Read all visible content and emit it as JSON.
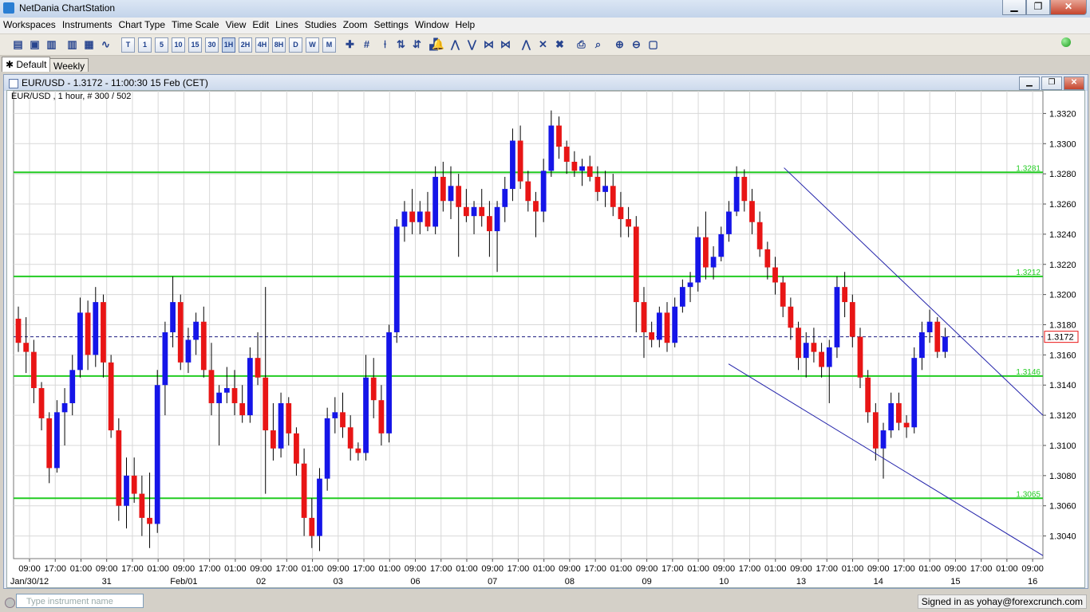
{
  "app": {
    "title": "NetDania ChartStation"
  },
  "menu": [
    "Workspaces",
    "Instruments",
    "Chart Type",
    "Time Scale",
    "View",
    "Edit",
    "Lines",
    "Studies",
    "Zoom",
    "Settings",
    "Window",
    "Help"
  ],
  "toolbar": {
    "timeframes": [
      "T",
      "1",
      "5",
      "10",
      "15",
      "30",
      "1H",
      "2H",
      "4H",
      "8H",
      "D",
      "W",
      "M"
    ],
    "selected_timeframe": "1H"
  },
  "tabs": [
    {
      "label": "Default",
      "active": true
    },
    {
      "label": "Weekly",
      "active": false
    }
  ],
  "chart_window": {
    "title": "EUR/USD - 1.3172 - 11:00:30  15 Feb (CET)",
    "info": "EUR/USD , 1 hour, # 300 / 502"
  },
  "statusbar": {
    "instrument_placeholder": "Type instrument name",
    "signed_in": "Signed in as yohay@forexcrunch.com"
  },
  "chart_data": {
    "type": "candlestick",
    "symbol": "EUR/USD",
    "interval": "1 hour",
    "ylim": [
      1.3025,
      1.3335
    ],
    "y_ticks": [
      "1.3320",
      "1.3300",
      "1.3280",
      "1.3260",
      "1.3240",
      "1.3220",
      "1.3200",
      "1.3180",
      "1.3160",
      "1.3140",
      "1.3120",
      "1.3100",
      "1.3080",
      "1.3060",
      "1.3040"
    ],
    "x_time_labels": [
      "09:00",
      "17:00",
      "01:00",
      "09:00",
      "17:00",
      "01:00",
      "09:00",
      "17:00",
      "01:00",
      "09:00",
      "17:00",
      "01:00",
      "09:00",
      "17:00",
      "01:00",
      "09:00",
      "17:00",
      "01:00",
      "09:00",
      "17:00",
      "01:00",
      "09:00",
      "17:00",
      "01:00",
      "09:00",
      "17:00",
      "01:00",
      "09:00",
      "17:00",
      "01:00",
      "09:00",
      "17:00",
      "01:00",
      "09:00",
      "17:00",
      "01:00",
      "09:00",
      "17:00",
      "01:00",
      "09:00"
    ],
    "x_date_labels": [
      {
        "label": "Jan/30/12",
        "index": 0
      },
      {
        "label": "31",
        "index": 3
      },
      {
        "label": "Feb/01",
        "index": 6
      },
      {
        "label": "02",
        "index": 9
      },
      {
        "label": "03",
        "index": 12
      },
      {
        "label": "06",
        "index": 15
      },
      {
        "label": "07",
        "index": 18
      },
      {
        "label": "08",
        "index": 21
      },
      {
        "label": "09",
        "index": 24
      },
      {
        "label": "10",
        "index": 27
      },
      {
        "label": "13",
        "index": 30
      },
      {
        "label": "14",
        "index": 33
      },
      {
        "label": "15",
        "index": 36
      },
      {
        "label": "16",
        "index": 39
      }
    ],
    "current_price": 1.3172,
    "current_price_label": "1.3172",
    "horizontal_lines": [
      {
        "value": 1.3281,
        "label": "1.3281"
      },
      {
        "value": 1.3212,
        "label": "1.3212"
      },
      {
        "value": 1.3146,
        "label": "1.3146"
      },
      {
        "value": 1.3065,
        "label": "1.3065"
      }
    ],
    "trend_lines": [
      {
        "from": [
          0.7485,
          1.3284
        ],
        "to": [
          1.0,
          1.312
        ]
      },
      {
        "from": [
          0.6946,
          1.3154
        ],
        "to": [
          1.0,
          1.3027
        ]
      }
    ],
    "candles": [
      [
        1.3184,
        1.3192,
        1.3162,
        1.3168
      ],
      [
        1.3168,
        1.3185,
        1.3148,
        1.3162
      ],
      [
        1.3162,
        1.317,
        1.3128,
        1.3138
      ],
      [
        1.3138,
        1.3142,
        1.311,
        1.3118
      ],
      [
        1.3118,
        1.3122,
        1.3075,
        1.3085
      ],
      [
        1.3085,
        1.313,
        1.3082,
        1.3122
      ],
      [
        1.3122,
        1.3138,
        1.31,
        1.3128
      ],
      [
        1.3128,
        1.316,
        1.312,
        1.315
      ],
      [
        1.315,
        1.3198,
        1.3145,
        1.3188
      ],
      [
        1.3188,
        1.3196,
        1.315,
        1.316
      ],
      [
        1.316,
        1.3205,
        1.3152,
        1.3195
      ],
      [
        1.3195,
        1.32,
        1.3145,
        1.3155
      ],
      [
        1.3155,
        1.316,
        1.3105,
        1.311
      ],
      [
        1.311,
        1.3118,
        1.305,
        1.306
      ],
      [
        1.306,
        1.3092,
        1.3045,
        1.308
      ],
      [
        1.308,
        1.3092,
        1.3062,
        1.3068
      ],
      [
        1.3068,
        1.308,
        1.304,
        1.3052
      ],
      [
        1.3052,
        1.3082,
        1.3032,
        1.3048
      ],
      [
        1.3048,
        1.315,
        1.3042,
        1.314
      ],
      [
        1.314,
        1.3182,
        1.312,
        1.3175
      ],
      [
        1.3175,
        1.3212,
        1.3165,
        1.3195
      ],
      [
        1.3195,
        1.32,
        1.315,
        1.3155
      ],
      [
        1.3155,
        1.3178,
        1.3148,
        1.317
      ],
      [
        1.317,
        1.3188,
        1.316,
        1.3182
      ],
      [
        1.3182,
        1.3192,
        1.3145,
        1.315
      ],
      [
        1.315,
        1.3168,
        1.312,
        1.3128
      ],
      [
        1.3128,
        1.314,
        1.31,
        1.3135
      ],
      [
        1.3135,
        1.3152,
        1.3128,
        1.3138
      ],
      [
        1.3138,
        1.315,
        1.312,
        1.3128
      ],
      [
        1.3128,
        1.314,
        1.3115,
        1.312
      ],
      [
        1.312,
        1.3165,
        1.3115,
        1.3158
      ],
      [
        1.3158,
        1.3175,
        1.314,
        1.3145
      ],
      [
        1.3145,
        1.3205,
        1.3068,
        1.311
      ],
      [
        1.311,
        1.3128,
        1.309,
        1.3098
      ],
      [
        1.3098,
        1.3135,
        1.3092,
        1.3128
      ],
      [
        1.3128,
        1.3132,
        1.31,
        1.3108
      ],
      [
        1.3108,
        1.3112,
        1.308,
        1.3088
      ],
      [
        1.3088,
        1.3098,
        1.304,
        1.3052
      ],
      [
        1.3052,
        1.3065,
        1.3032,
        1.304
      ],
      [
        1.304,
        1.3085,
        1.303,
        1.3078
      ],
      [
        1.3078,
        1.3125,
        1.307,
        1.3118
      ],
      [
        1.3118,
        1.3132,
        1.3108,
        1.3122
      ],
      [
        1.3122,
        1.3135,
        1.3105,
        1.3112
      ],
      [
        1.3112,
        1.312,
        1.309,
        1.3098
      ],
      [
        1.3098,
        1.3102,
        1.309,
        1.3095
      ],
      [
        1.3095,
        1.316,
        1.309,
        1.3145
      ],
      [
        1.3145,
        1.3158,
        1.3118,
        1.313
      ],
      [
        1.313,
        1.314,
        1.31,
        1.3108
      ],
      [
        1.3108,
        1.318,
        1.3102,
        1.3175
      ],
      [
        1.3175,
        1.325,
        1.3168,
        1.3245
      ],
      [
        1.3245,
        1.3262,
        1.3235,
        1.3255
      ],
      [
        1.3255,
        1.327,
        1.324,
        1.3248
      ],
      [
        1.3248,
        1.3262,
        1.324,
        1.3255
      ],
      [
        1.3255,
        1.3268,
        1.3242,
        1.3245
      ],
      [
        1.3245,
        1.3285,
        1.324,
        1.3278
      ],
      [
        1.3278,
        1.3288,
        1.3255,
        1.3262
      ],
      [
        1.3262,
        1.3285,
        1.325,
        1.3272
      ],
      [
        1.3272,
        1.328,
        1.3225,
        1.3258
      ],
      [
        1.3258,
        1.327,
        1.3248,
        1.3252
      ],
      [
        1.3252,
        1.3262,
        1.324,
        1.3258
      ],
      [
        1.3258,
        1.327,
        1.3245,
        1.3252
      ],
      [
        1.3252,
        1.3262,
        1.3225,
        1.3242
      ],
      [
        1.3242,
        1.3262,
        1.3215,
        1.3258
      ],
      [
        1.3258,
        1.3278,
        1.3248,
        1.327
      ],
      [
        1.327,
        1.331,
        1.3262,
        1.3302
      ],
      [
        1.3302,
        1.3312,
        1.327,
        1.3275
      ],
      [
        1.3275,
        1.3282,
        1.3255,
        1.3262
      ],
      [
        1.3262,
        1.3268,
        1.3238,
        1.3255
      ],
      [
        1.3255,
        1.329,
        1.3248,
        1.3282
      ],
      [
        1.3282,
        1.3322,
        1.3278,
        1.3312
      ],
      [
        1.3312,
        1.3318,
        1.329,
        1.3298
      ],
      [
        1.3298,
        1.3302,
        1.328,
        1.3288
      ],
      [
        1.3288,
        1.3295,
        1.3278,
        1.3282
      ],
      [
        1.3282,
        1.329,
        1.3272,
        1.3285
      ],
      [
        1.3285,
        1.3292,
        1.3275,
        1.3278
      ],
      [
        1.3278,
        1.3285,
        1.3262,
        1.3268
      ],
      [
        1.3268,
        1.3282,
        1.3258,
        1.3272
      ],
      [
        1.3272,
        1.328,
        1.3252,
        1.3258
      ],
      [
        1.3258,
        1.3268,
        1.3238,
        1.325
      ],
      [
        1.325,
        1.3258,
        1.3238,
        1.3245
      ],
      [
        1.3245,
        1.3252,
        1.3175,
        1.3195
      ],
      [
        1.3195,
        1.3205,
        1.3158,
        1.3175
      ],
      [
        1.3175,
        1.3182,
        1.3165,
        1.317
      ],
      [
        1.317,
        1.3192,
        1.3165,
        1.3188
      ],
      [
        1.3188,
        1.3195,
        1.3162,
        1.3168
      ],
      [
        1.3168,
        1.3198,
        1.3165,
        1.3192
      ],
      [
        1.3192,
        1.321,
        1.3188,
        1.3205
      ],
      [
        1.3205,
        1.3215,
        1.3195,
        1.3208
      ],
      [
        1.3208,
        1.3245,
        1.3202,
        1.3238
      ],
      [
        1.3238,
        1.3255,
        1.321,
        1.3218
      ],
      [
        1.3218,
        1.3232,
        1.321,
        1.3225
      ],
      [
        1.3225,
        1.3245,
        1.3222,
        1.324
      ],
      [
        1.324,
        1.3262,
        1.3235,
        1.3255
      ],
      [
        1.3255,
        1.3285,
        1.3252,
        1.3278
      ],
      [
        1.3278,
        1.3283,
        1.3255,
        1.3262
      ],
      [
        1.3262,
        1.327,
        1.324,
        1.3248
      ],
      [
        1.3248,
        1.3255,
        1.3225,
        1.323
      ],
      [
        1.323,
        1.3235,
        1.321,
        1.3218
      ],
      [
        1.3218,
        1.3225,
        1.32,
        1.3208
      ],
      [
        1.3208,
        1.3212,
        1.3185,
        1.3192
      ],
      [
        1.3192,
        1.3198,
        1.317,
        1.3178
      ],
      [
        1.3178,
        1.3182,
        1.315,
        1.3158
      ],
      [
        1.3158,
        1.3175,
        1.3145,
        1.3168
      ],
      [
        1.3168,
        1.3178,
        1.3155,
        1.3162
      ],
      [
        1.3162,
        1.3168,
        1.3145,
        1.3152
      ],
      [
        1.3152,
        1.317,
        1.3128,
        1.3165
      ],
      [
        1.3165,
        1.3212,
        1.3158,
        1.3205
      ],
      [
        1.3205,
        1.3215,
        1.3185,
        1.3195
      ],
      [
        1.3195,
        1.32,
        1.3165,
        1.3172
      ],
      [
        1.3172,
        1.3178,
        1.3138,
        1.3145
      ],
      [
        1.3145,
        1.315,
        1.3115,
        1.3122
      ],
      [
        1.3122,
        1.3128,
        1.309,
        1.3098
      ],
      [
        1.3098,
        1.3115,
        1.3078,
        1.311
      ],
      [
        1.311,
        1.3135,
        1.3105,
        1.3128
      ],
      [
        1.3128,
        1.3135,
        1.311,
        1.3115
      ],
      [
        1.3115,
        1.312,
        1.3105,
        1.3112
      ],
      [
        1.3112,
        1.3165,
        1.3108,
        1.3158
      ],
      [
        1.3158,
        1.3182,
        1.315,
        1.3175
      ],
      [
        1.3175,
        1.319,
        1.3168,
        1.3182
      ],
      [
        1.3182,
        1.3185,
        1.3158,
        1.3162
      ],
      [
        1.3162,
        1.3178,
        1.3158,
        1.3172
      ]
    ]
  }
}
